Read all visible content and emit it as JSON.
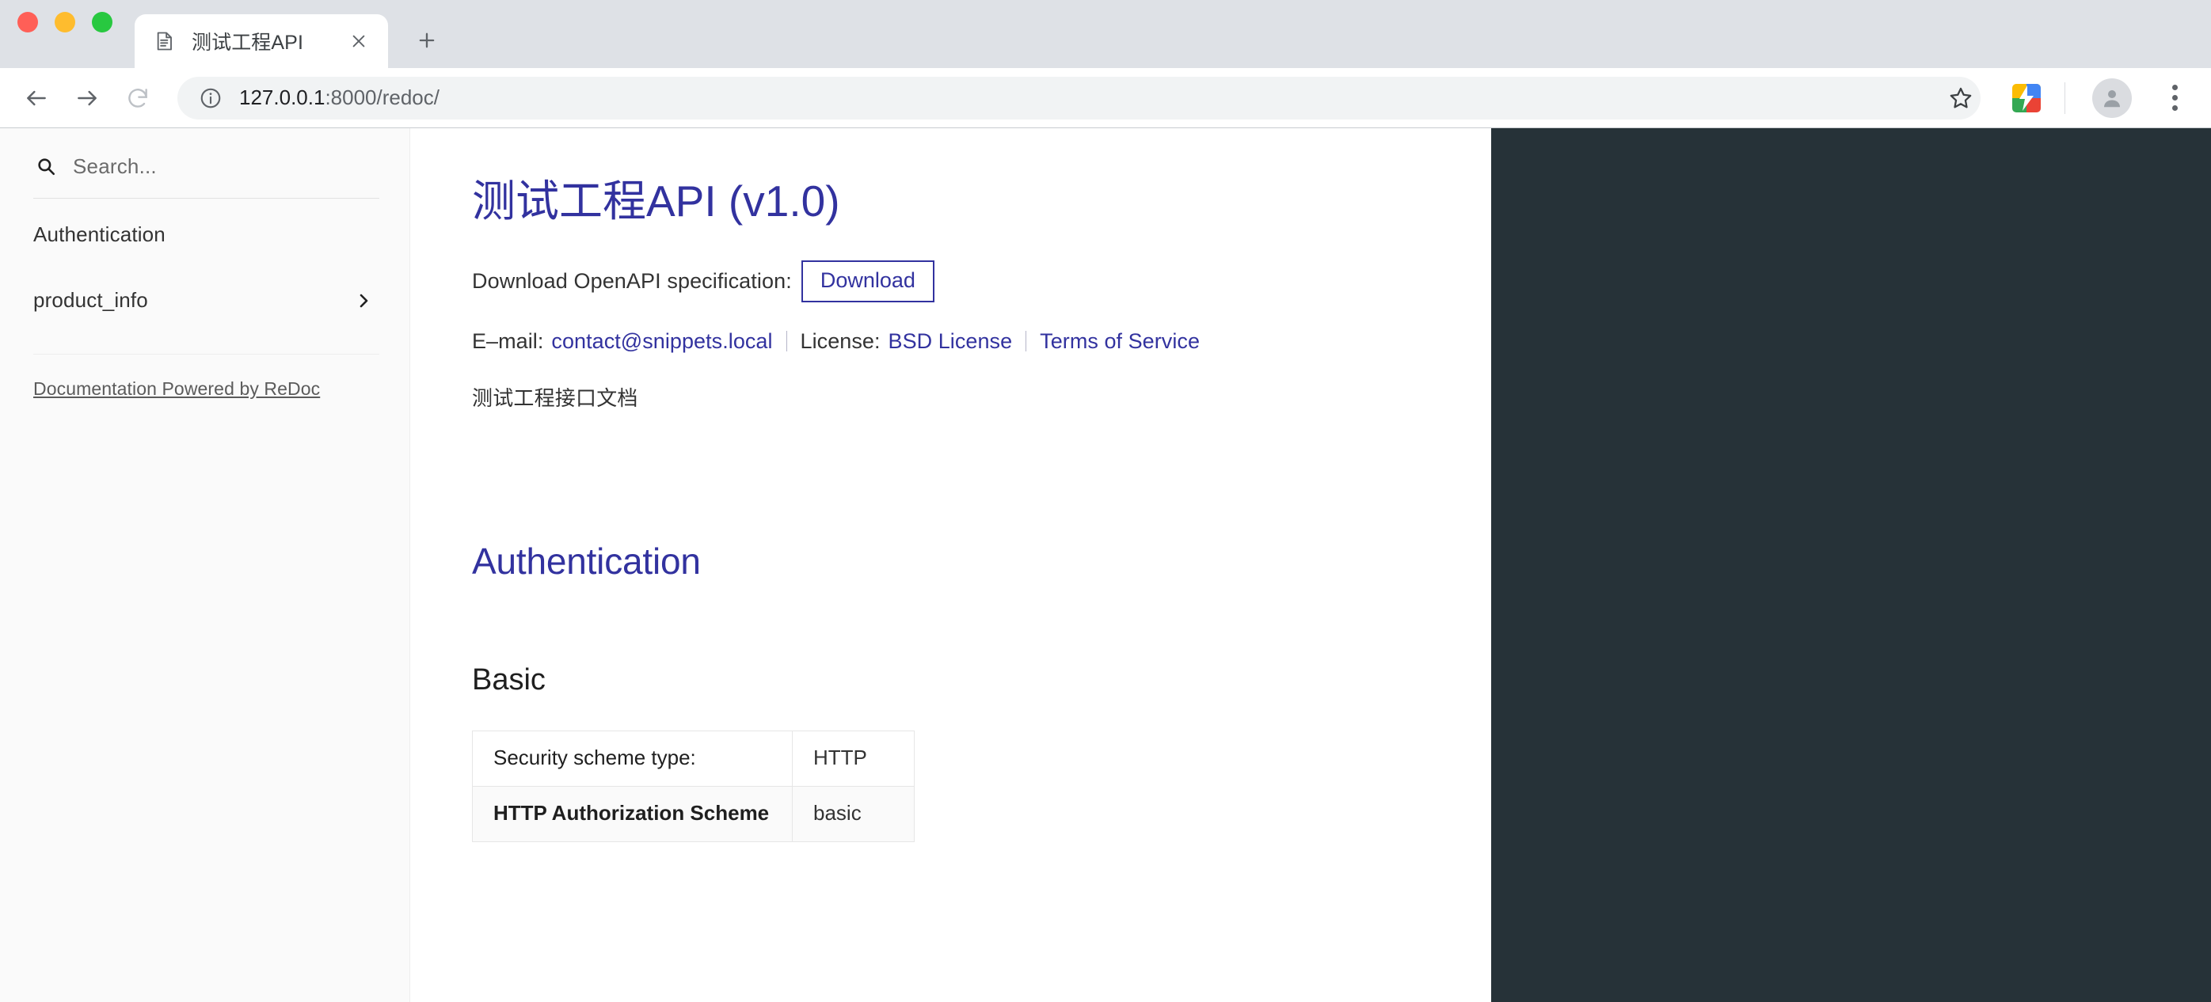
{
  "browser": {
    "tab": {
      "title": "测试工程API",
      "favicon": "document-icon",
      "close_label": "×"
    },
    "new_tab_label": "+",
    "toolbar": {
      "back": "back-arrow",
      "forward": "forward-arrow",
      "reload": "reload-arrow",
      "url_host": "127.0.0.1",
      "url_rest": ":8000/redoc/",
      "info_icon": "info-circle-icon",
      "star_icon": "bookmark-star-icon",
      "extension_icon": "extension-icon",
      "avatar_icon": "profile-avatar-icon",
      "menu_icon": "three-dot-menu-icon"
    },
    "window_controls": [
      "close",
      "minimize",
      "maximize"
    ]
  },
  "sidebar": {
    "search": {
      "placeholder": "Search...",
      "icon": "search-icon"
    },
    "items": [
      {
        "label": "Authentication",
        "has_chevron": false
      },
      {
        "label": "product_info",
        "has_chevron": true,
        "chevron": "›"
      }
    ],
    "footer_link": "Documentation Powered by ReDoc"
  },
  "main": {
    "api_title": "测试工程API (v1.0)",
    "download": {
      "label": "Download OpenAPI specification:",
      "button": "Download"
    },
    "meta": {
      "email_label": "E–mail:",
      "email_value": "contact@snippets.local",
      "license_label": "License:",
      "license_value": "BSD License",
      "terms": "Terms of Service"
    },
    "description": "测试工程接口文档",
    "auth_section": {
      "heading": "Authentication",
      "subheading": "Basic",
      "table": [
        {
          "key": "Security scheme type:",
          "value": "HTTP",
          "bold": false
        },
        {
          "key": "HTTP Authorization Scheme",
          "value": "basic",
          "bold": true
        }
      ]
    }
  },
  "colors": {
    "accent": "#32329f",
    "dark_panel": "#263238",
    "sidebar_bg": "#fafafa"
  }
}
